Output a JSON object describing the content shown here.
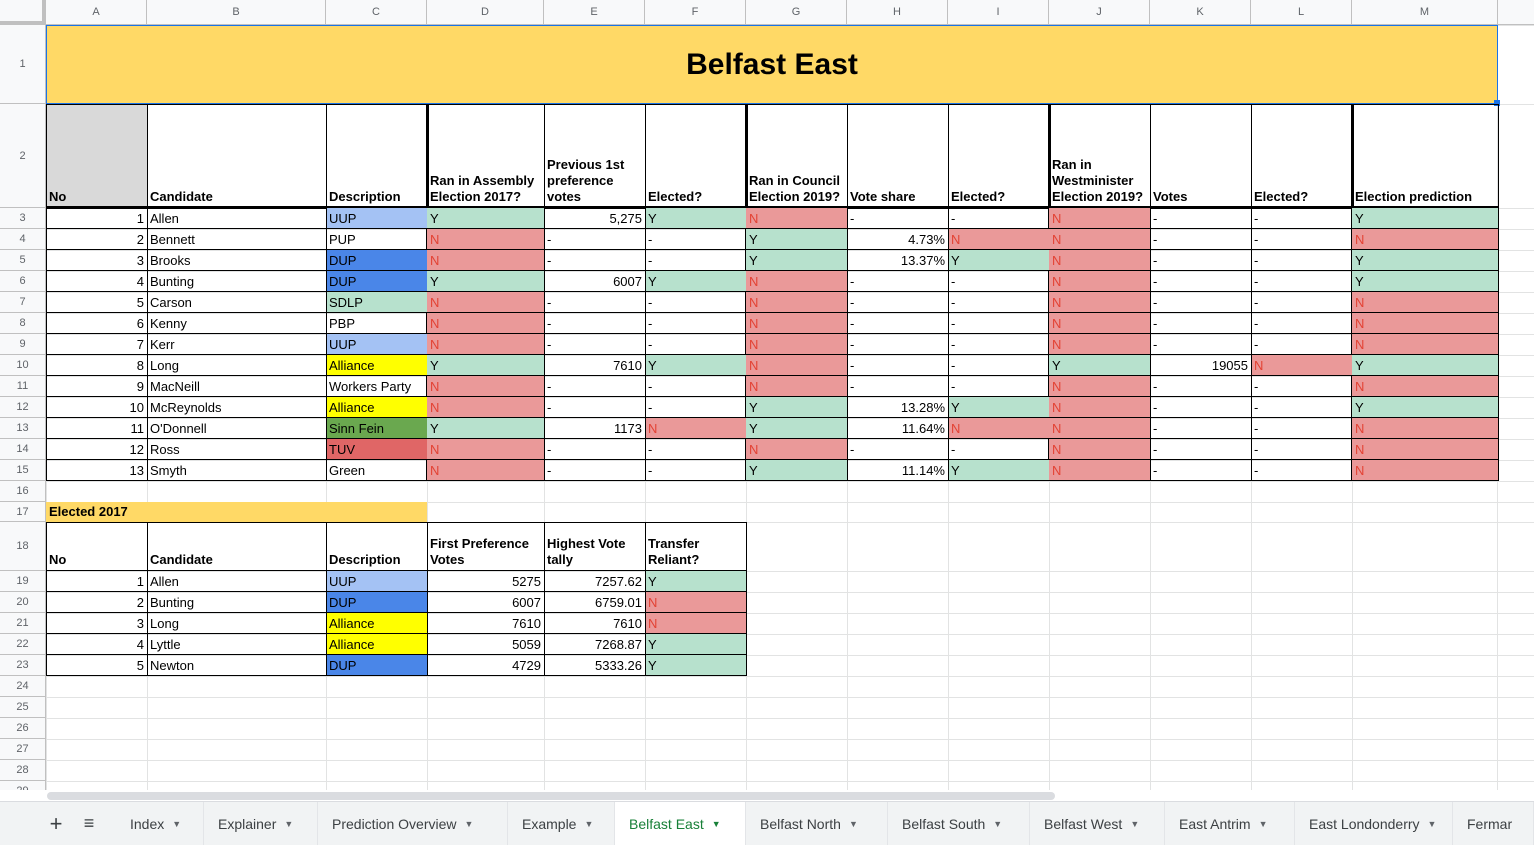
{
  "columns": [
    "A",
    "B",
    "C",
    "D",
    "E",
    "F",
    "G",
    "H",
    "I",
    "J",
    "K",
    "L",
    "M"
  ],
  "rows": [
    "1",
    "2",
    "3",
    "4",
    "5",
    "6",
    "7",
    "8",
    "9",
    "10",
    "11",
    "12",
    "13",
    "14",
    "15",
    "16",
    "17",
    "18",
    "19",
    "20",
    "21",
    "22",
    "23",
    "24",
    "25",
    "26",
    "27",
    "28",
    "29"
  ],
  "colors": {
    "title_bg": "#ffd966",
    "yes": "#b7e1cd",
    "no": "#ea9999",
    "UUP": "#a4c2f4",
    "DUP": "#4a86e8",
    "Alliance": "#ffff00",
    "SDLP": "#b7e1cd",
    "Sinn Fein": "#6aa84f",
    "TUV": "#e06666",
    "header_no_bg": "#d9d9d9",
    "selection": "#1a73e8"
  },
  "title": "Belfast East",
  "main_table": {
    "headers": [
      "No",
      "Candidate",
      "Description",
      "Ran in Assembly Election 2017?",
      "Previous 1st preference votes",
      "Elected?",
      "Ran in Council Election 2019?",
      "Vote share",
      "Elected?",
      "Ran in Westminister Election 2019?",
      "Votes",
      "Elected?",
      "Election prediction"
    ],
    "rows": [
      [
        "1",
        "Allen",
        "UUP",
        "Y",
        "5,275",
        "Y",
        "N",
        "-",
        "-",
        "N",
        "-",
        "-",
        "Y"
      ],
      [
        "2",
        "Bennett",
        "PUP",
        "N",
        "-",
        "-",
        "Y",
        "4.73%",
        "N",
        "N",
        "-",
        "-",
        "N"
      ],
      [
        "3",
        "Brooks",
        "DUP",
        "N",
        "-",
        "-",
        "Y",
        "13.37%",
        "Y",
        "N",
        "-",
        "-",
        "Y"
      ],
      [
        "4",
        "Bunting",
        "DUP",
        "Y",
        "6007",
        "Y",
        "N",
        "-",
        "-",
        "N",
        "-",
        "-",
        "Y"
      ],
      [
        "5",
        "Carson",
        "SDLP",
        "N",
        "-",
        "-",
        "N",
        "-",
        "-",
        "N",
        "-",
        "-",
        "N"
      ],
      [
        "6",
        "Kenny",
        "PBP",
        "N",
        "-",
        "-",
        "N",
        "-",
        "-",
        "N",
        "-",
        "-",
        "N"
      ],
      [
        "7",
        "Kerr",
        "UUP",
        "N",
        "-",
        "-",
        "N",
        "-",
        "-",
        "N",
        "-",
        "-",
        "N"
      ],
      [
        "8",
        "Long",
        "Alliance",
        "Y",
        "7610",
        "Y",
        "N",
        "-",
        "-",
        "Y",
        "19055",
        "N",
        "Y"
      ],
      [
        "9",
        "MacNeill",
        "Workers Party",
        "N",
        "-",
        "-",
        "N",
        "-",
        "-",
        "N",
        "-",
        "-",
        "N"
      ],
      [
        "10",
        "McReynolds",
        "Alliance",
        "N",
        "-",
        "-",
        "Y",
        "13.28%",
        "Y",
        "N",
        "-",
        "-",
        "Y"
      ],
      [
        "11",
        "O'Donnell",
        "Sinn Fein",
        "Y",
        "1173",
        "N",
        "Y",
        "11.64%",
        "N",
        "N",
        "-",
        "-",
        "N"
      ],
      [
        "12",
        "Ross",
        "TUV",
        "N",
        "-",
        "-",
        "N",
        "-",
        "-",
        "N",
        "-",
        "-",
        "N"
      ],
      [
        "13",
        "Smyth",
        "Green",
        "N",
        "-",
        "-",
        "Y",
        "11.14%",
        "Y",
        "N",
        "-",
        "-",
        "N"
      ]
    ]
  },
  "elected_table": {
    "title": "Elected 2017",
    "headers": [
      "No",
      "Candidate",
      "Description",
      "First Preference Votes",
      "Highest Vote tally",
      "Transfer Reliant?"
    ],
    "rows": [
      [
        "1",
        "Allen",
        "UUP",
        "5275",
        "7257.62",
        "Y"
      ],
      [
        "2",
        "Bunting",
        "DUP",
        "6007",
        "6759.01",
        "N"
      ],
      [
        "3",
        "Long",
        "Alliance",
        "7610",
        "7610",
        "N"
      ],
      [
        "4",
        "Lyttle",
        "Alliance",
        "5059",
        "7268.87",
        "Y"
      ],
      [
        "5",
        "Newton",
        "DUP",
        "4729",
        "5333.26",
        "Y"
      ]
    ]
  },
  "tabs": [
    {
      "label": "Index"
    },
    {
      "label": "Explainer"
    },
    {
      "label": "Prediction Overview"
    },
    {
      "label": "Example"
    },
    {
      "label": "Belfast East",
      "active": true
    },
    {
      "label": "Belfast North"
    },
    {
      "label": "Belfast South"
    },
    {
      "label": "Belfast West"
    },
    {
      "label": "East Antrim"
    },
    {
      "label": "East Londonderry"
    },
    {
      "label": "Fermar"
    }
  ],
  "icons": {
    "add_sheet": "plus-icon",
    "all_sheets": "list-icon",
    "dropdown": "caret-down-icon"
  }
}
